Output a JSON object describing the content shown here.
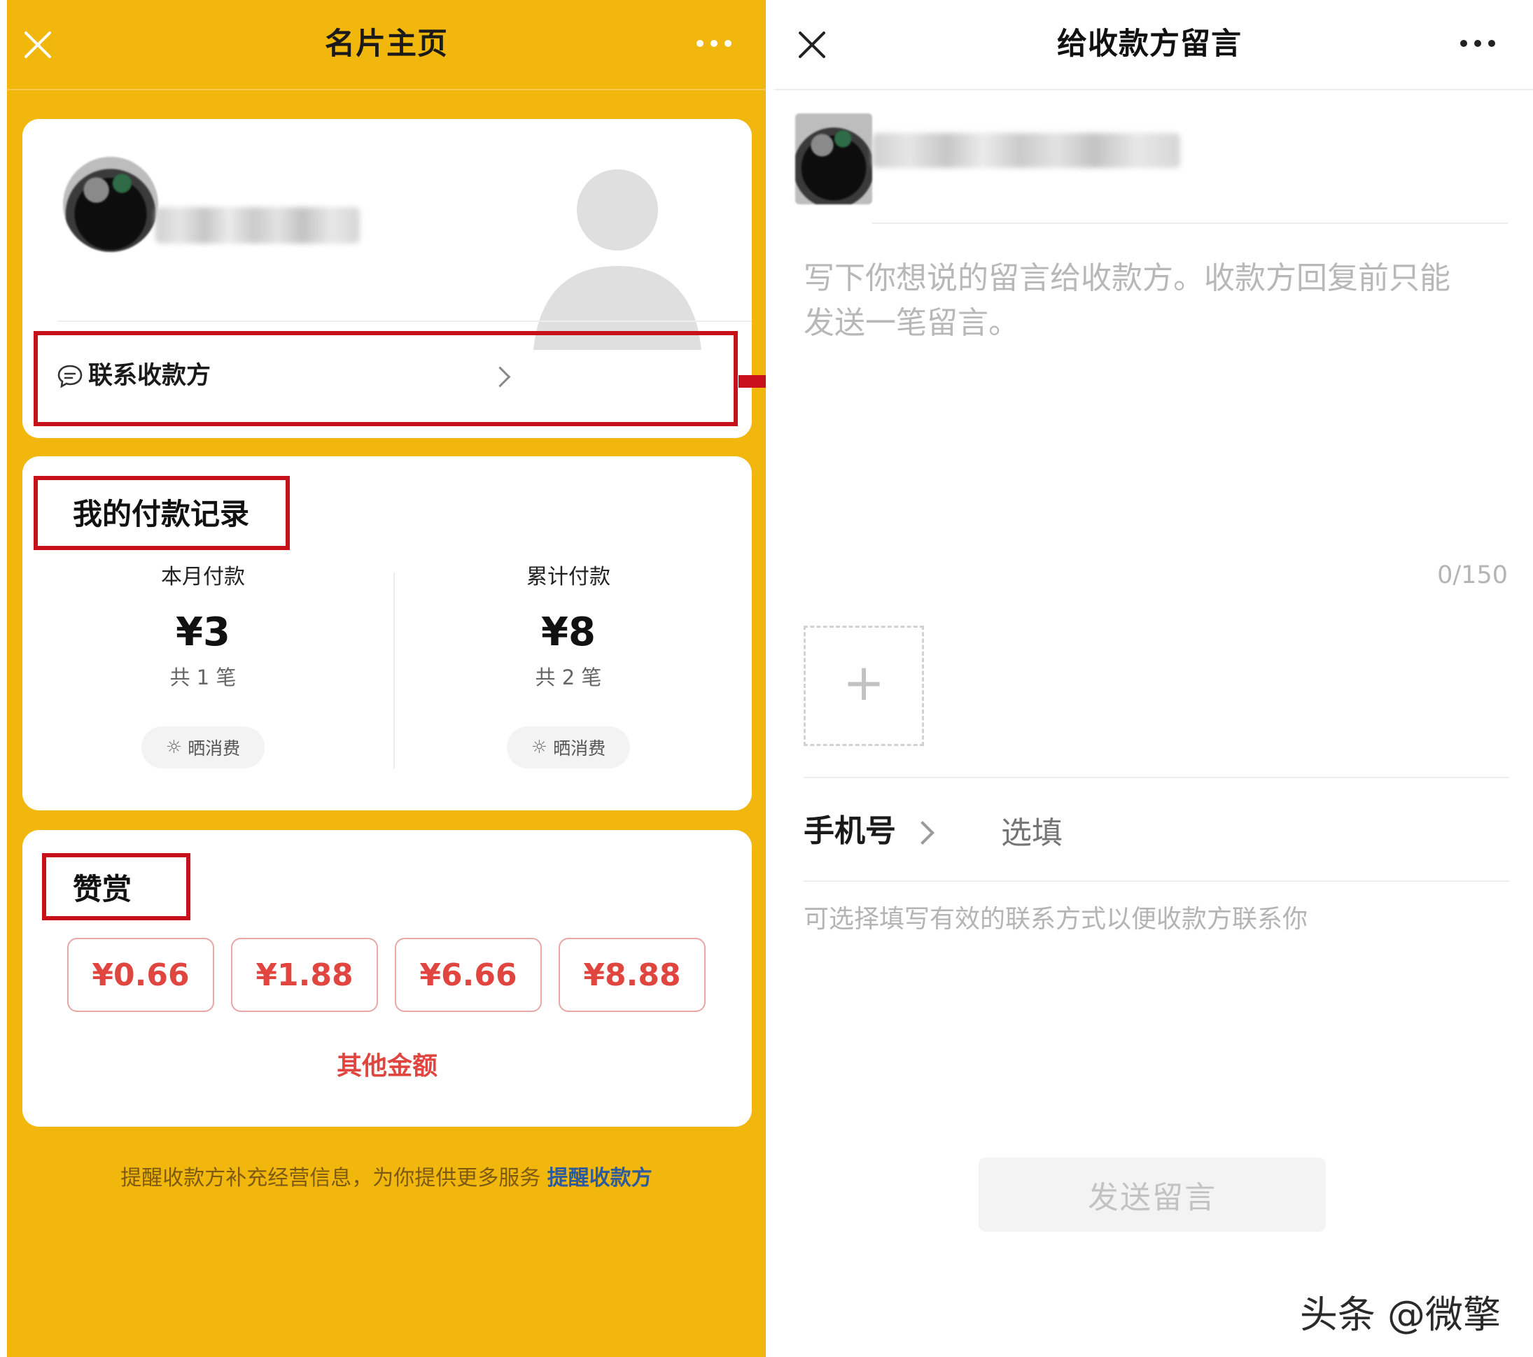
{
  "left_screen": {
    "header": {
      "title": "名片主页"
    },
    "contact_row": {
      "label": "联系收款方"
    },
    "payment_record": {
      "title": "我的付款记录",
      "this_month": {
        "label": "本月付款",
        "amount": "¥3",
        "count": "共 1 笔",
        "share": "晒消费"
      },
      "total": {
        "label": "累计付款",
        "amount": "¥8",
        "count": "共 2 笔",
        "share": "晒消费"
      }
    },
    "tip": {
      "title": "赞赏",
      "amounts": [
        "¥0.66",
        "¥1.88",
        "¥6.66",
        "¥8.88"
      ],
      "other": "其他金额"
    },
    "footer": {
      "text": "提醒收款方补充经营信息，为你提供更多服务",
      "link": "提醒收款方"
    }
  },
  "right_screen": {
    "header": {
      "title": "给收款方留言"
    },
    "message": {
      "placeholder_line1": "写下你想说的留言给收款方。收款方回复前只能",
      "placeholder_line2": "发送一笔留言。",
      "counter": "0/150"
    },
    "phone": {
      "label": "手机号",
      "placeholder": "选填"
    },
    "hint": "可选择填写有效的联系方式以便收款方联系你",
    "send_button": "发送留言"
  },
  "watermark": "头条 @微擎",
  "colors": {
    "left_background": "#f2b70d",
    "highlight_box": "#c8101a",
    "tip_red": "#e0453f",
    "link_blue": "#2d5b9c"
  }
}
